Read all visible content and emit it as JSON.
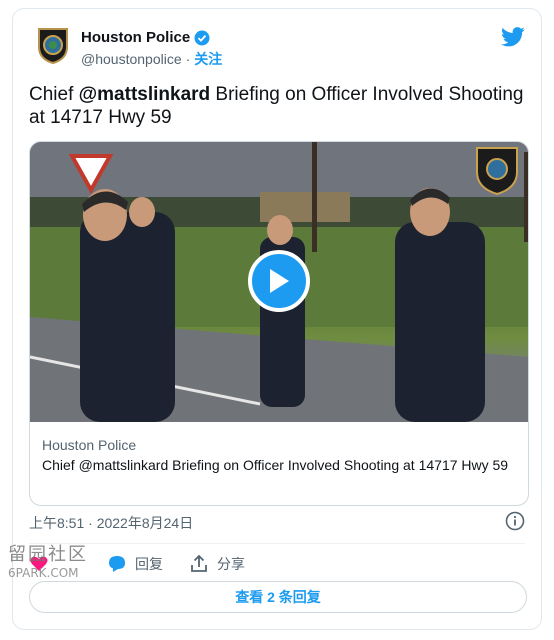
{
  "account": {
    "name": "Houston Police",
    "handle": "@houstonpolice",
    "separator": "·",
    "follow_label": "关注"
  },
  "tweet": {
    "text_prefix": "Chief ",
    "mention": "@mattslinkard",
    "text_suffix": " Briefing on Officer Involved Shooting at 14717 Hwy 59"
  },
  "media": {
    "source": "Houston Police",
    "title": "Chief @mattslinkard Briefing on Officer Involved Shooting at 14717 Hwy 59"
  },
  "meta": {
    "timestamp": "上午8:51 · 2022年8月24日"
  },
  "actions": {
    "reply_label": "回复",
    "share_label": "分享"
  },
  "reply_bar": {
    "label": "查看 2 条回复"
  },
  "watermark": {
    "cjk": "留园社区",
    "site": "6PARK.COM"
  },
  "colors": {
    "accent": "#1d9bf0",
    "like": "#f91880",
    "text": "#0f1419",
    "secondary": "#536471"
  }
}
